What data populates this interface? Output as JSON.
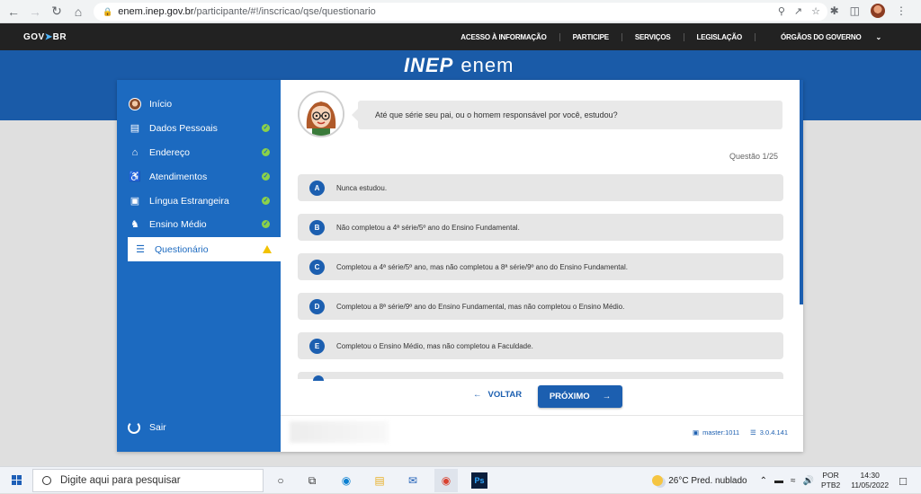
{
  "browser": {
    "url_host": "enem.inep.gov.br",
    "url_path": "/participante/#!/inscricao/qse/questionario"
  },
  "gov_bar": {
    "logo_left": "GOV",
    "logo_right": "BR",
    "links": [
      "ACESSO À INFORMAÇÃO",
      "PARTICIPE",
      "SERVIÇOS",
      "LEGISLAÇÃO",
      "ÓRGÃOS DO GOVERNO"
    ]
  },
  "brand": {
    "inep": "INEP",
    "enem": "enem"
  },
  "sidebar": {
    "items": [
      {
        "label": "Início",
        "status": "none"
      },
      {
        "label": "Dados Pessoais",
        "status": "done"
      },
      {
        "label": "Endereço",
        "status": "done"
      },
      {
        "label": "Atendimentos",
        "status": "done"
      },
      {
        "label": "Língua Estrangeira",
        "status": "done"
      },
      {
        "label": "Ensino Médio",
        "status": "done"
      },
      {
        "label": "Questionário",
        "status": "warning"
      }
    ],
    "logout": "Sair"
  },
  "question": {
    "text": "Até que série seu pai, ou o homem responsável por você, estudou?",
    "counter": "Questão 1/25",
    "options": [
      {
        "letter": "A",
        "text": "Nunca estudou."
      },
      {
        "letter": "B",
        "text": "Não completou a 4ª série/5º ano do Ensino Fundamental."
      },
      {
        "letter": "C",
        "text": "Completou a 4ª série/5º ano, mas não completou a 8ª série/9º ano do Ensino Fundamental."
      },
      {
        "letter": "D",
        "text": "Completou a 8ª série/9º ano do Ensino Fundamental, mas não completou o Ensino Médio."
      },
      {
        "letter": "E",
        "text": "Completou o Ensino Médio, mas não completou a Faculdade."
      }
    ]
  },
  "nav": {
    "back": "VOLTAR",
    "next": "PRÓXIMO"
  },
  "footer": {
    "master": "master:1011",
    "version": "3.0.4.141"
  },
  "taskbar": {
    "search_placeholder": "Digite aqui para pesquisar",
    "weather": "26°C  Pred. nublado",
    "lang_top": "POR",
    "lang_bottom": "PTB2",
    "time": "14:30",
    "date": "11/05/2022"
  },
  "colors": {
    "brand_blue": "#1c6ac0",
    "header_blue": "#1a5ba8",
    "check_green": "#8ad14a",
    "warning_yellow": "#f2c200"
  }
}
